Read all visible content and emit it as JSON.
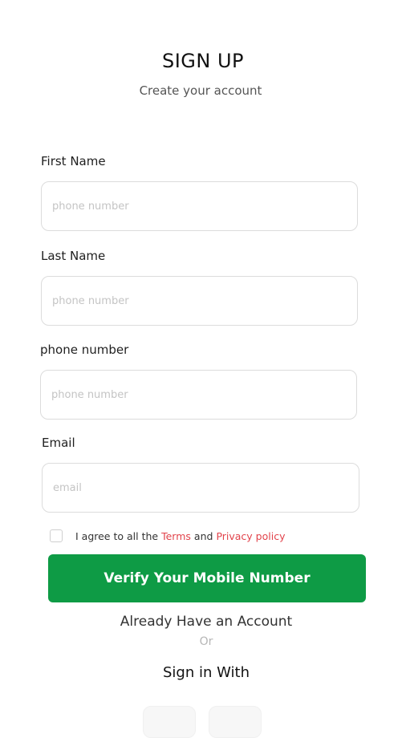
{
  "header": {
    "title": "SIGN UP",
    "subtitle": "Create your account"
  },
  "form": {
    "first_name": {
      "label": "First Name",
      "placeholder": "phone number",
      "value": ""
    },
    "last_name": {
      "label": "Last Name",
      "placeholder": "phone number",
      "value": ""
    },
    "phone": {
      "label": "phone number",
      "placeholder": "phone number",
      "value": ""
    },
    "email": {
      "label": "Email",
      "placeholder": "email",
      "value": ""
    }
  },
  "agreement": {
    "checked": false,
    "prefix": "I agree to all the",
    "terms": "Terms",
    "and": "and",
    "privacy": "Privacy policy"
  },
  "verify_button": {
    "label": "Verify Your Mobile Number"
  },
  "footer": {
    "already": "Already Have an Account",
    "or": "Or",
    "sign_in_with": "Sign in With"
  },
  "colors": {
    "primary_green": "#0e9b45",
    "link_red": "#e2434b",
    "border": "#dcdcdc"
  }
}
